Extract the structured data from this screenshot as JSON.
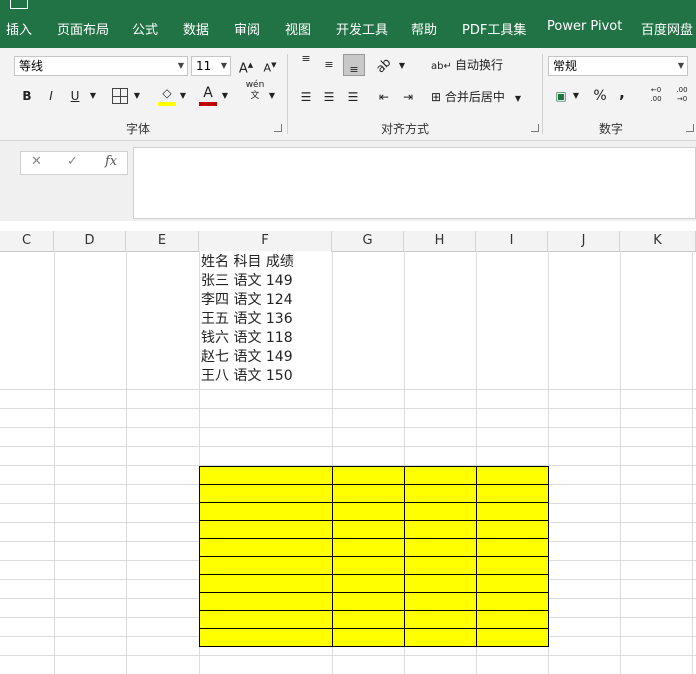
{
  "ribbon_tabs": [
    "插入",
    "页面布局",
    "公式",
    "数据",
    "审阅",
    "视图",
    "开发工具",
    "帮助",
    "PDF工具集",
    "Power Pivot",
    "百度网盘"
  ],
  "font": {
    "family": "等线",
    "size": "11",
    "grow_label": "A",
    "shrink_label": "A",
    "bold": "B",
    "italic": "I",
    "underline": "U",
    "phonetic": "wén",
    "phonetic_char": "文",
    "group_label": "字体"
  },
  "alignment": {
    "wrap_text": "自动换行",
    "merge_center": "合并后居中",
    "group_label": "对齐方式"
  },
  "number": {
    "format": "常规",
    "percent": "%",
    "comma": ",",
    "increase_decimal": "←0 .00",
    "decrease_decimal": ".00 →0",
    "group_label": "数字"
  },
  "formula_bar": {
    "cancel": "✕",
    "enter": "✓",
    "fx": "fx",
    "value": ""
  },
  "columns": [
    "C",
    "D",
    "E",
    "F",
    "G",
    "H",
    "I",
    "J",
    "K"
  ],
  "cell_text_lines": [
    "姓名 科目 成绩",
    "张三 语文 149",
    "李四 语文 124",
    "王五 语文 136",
    "钱六 语文 118",
    "赵七 语文 149",
    "王八 语文 150"
  ],
  "colors": {
    "ribbon_tab_bg": "#217346",
    "highlight": "#ffff00",
    "font_color": "#c00000"
  }
}
